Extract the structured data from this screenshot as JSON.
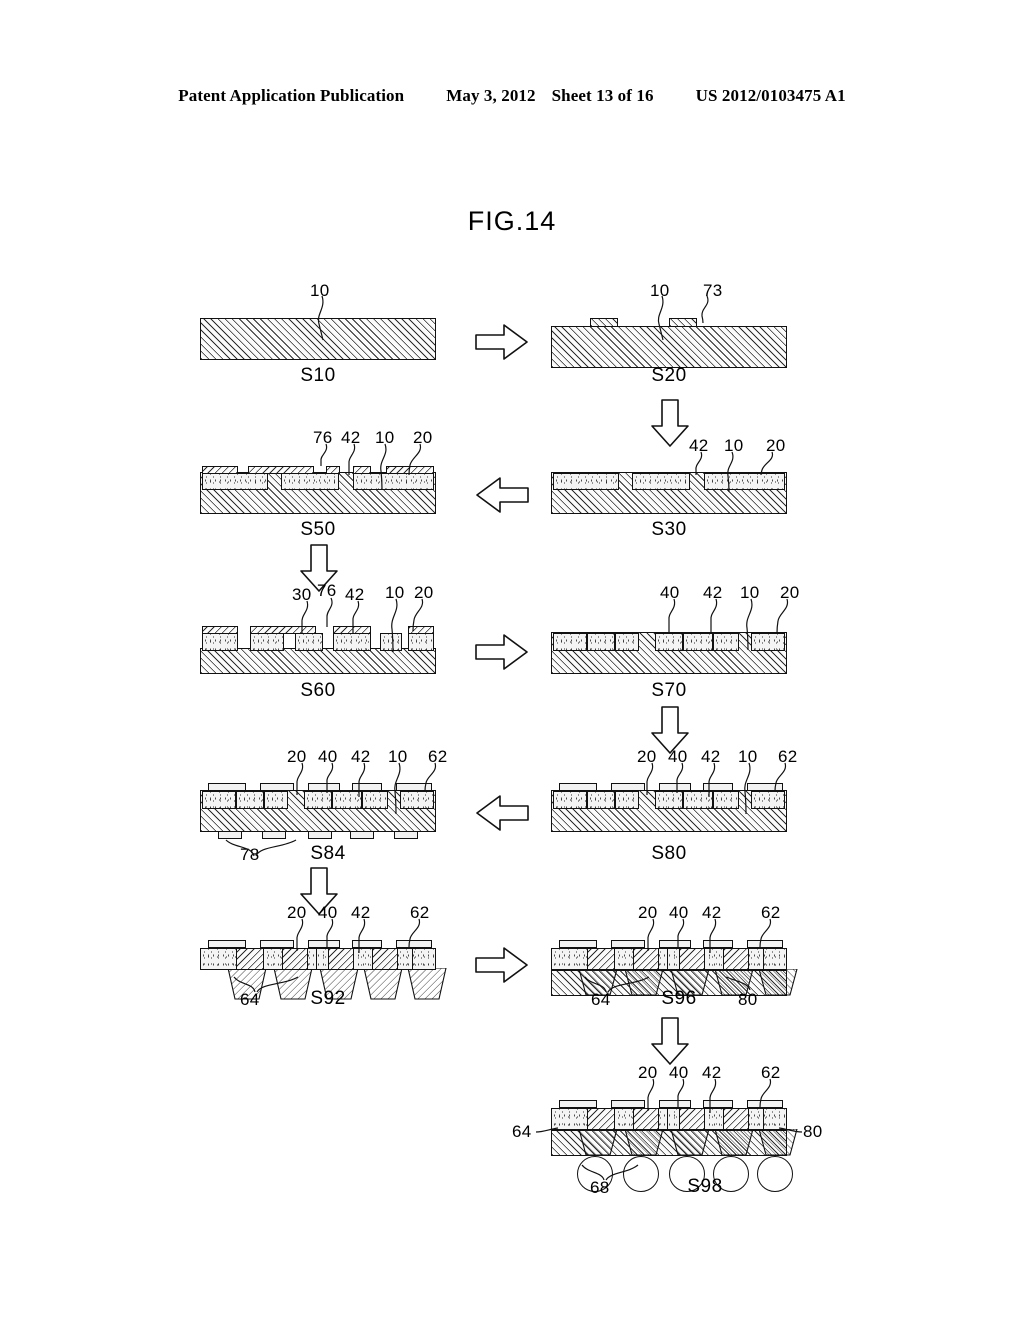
{
  "header": {
    "publication": "Patent Application Publication",
    "date": "May 3, 2012",
    "sheet": "Sheet 13 of 16",
    "docnum": "US 2012/0103475 A1"
  },
  "figure": {
    "title": "FIG.14",
    "caption_prefix": "S"
  },
  "steps": [
    {
      "id": "S10",
      "caption": "S10",
      "labels": [
        {
          "text": "10"
        }
      ]
    },
    {
      "id": "S20",
      "caption": "S20",
      "labels": [
        {
          "text": "10"
        },
        {
          "text": "73"
        }
      ]
    },
    {
      "id": "S30",
      "caption": "S30",
      "labels": [
        {
          "text": "42"
        },
        {
          "text": "10"
        },
        {
          "text": "20"
        }
      ]
    },
    {
      "id": "S50",
      "caption": "S50",
      "labels": [
        {
          "text": "76"
        },
        {
          "text": "42"
        },
        {
          "text": "10"
        },
        {
          "text": "20"
        }
      ]
    },
    {
      "id": "S60",
      "caption": "S60",
      "labels": [
        {
          "text": "30"
        },
        {
          "text": "76"
        },
        {
          "text": "42"
        },
        {
          "text": "10"
        },
        {
          "text": "20"
        }
      ]
    },
    {
      "id": "S70",
      "caption": "S70",
      "labels": [
        {
          "text": "40"
        },
        {
          "text": "42"
        },
        {
          "text": "10"
        },
        {
          "text": "20"
        }
      ]
    },
    {
      "id": "S80",
      "caption": "S80",
      "labels": [
        {
          "text": "20"
        },
        {
          "text": "40"
        },
        {
          "text": "42"
        },
        {
          "text": "10"
        },
        {
          "text": "62"
        }
      ]
    },
    {
      "id": "S84",
      "caption": "S84",
      "labels": [
        {
          "text": "20"
        },
        {
          "text": "40"
        },
        {
          "text": "42"
        },
        {
          "text": "10"
        },
        {
          "text": "62"
        },
        {
          "text": "78"
        }
      ]
    },
    {
      "id": "S92",
      "caption": "S92",
      "labels": [
        {
          "text": "20"
        },
        {
          "text": "40"
        },
        {
          "text": "42"
        },
        {
          "text": "62"
        },
        {
          "text": "64"
        }
      ]
    },
    {
      "id": "S96",
      "caption": "S96",
      "labels": [
        {
          "text": "20"
        },
        {
          "text": "40"
        },
        {
          "text": "42"
        },
        {
          "text": "62"
        },
        {
          "text": "64"
        },
        {
          "text": "80"
        }
      ]
    },
    {
      "id": "S98",
      "caption": "S98",
      "labels": [
        {
          "text": "20"
        },
        {
          "text": "40"
        },
        {
          "text": "42"
        },
        {
          "text": "62"
        },
        {
          "text": "64"
        },
        {
          "text": "80"
        },
        {
          "text": "68"
        }
      ]
    }
  ],
  "label_text": {
    "n10": "10",
    "n20": "20",
    "n30": "30",
    "n40": "40",
    "n42": "42",
    "n62": "62",
    "n64": "64",
    "n68": "68",
    "n73": "73",
    "n76": "76",
    "n78": "78",
    "n80": "80"
  },
  "captions": {
    "s10": "S10",
    "s20": "S20",
    "s30": "S30",
    "s50": "S50",
    "s60": "S60",
    "s70": "S70",
    "s80": "S80",
    "s84": "S84",
    "s92": "S92",
    "s96": "S96",
    "s98": "S98"
  },
  "flow_arrows": [
    {
      "name": "arrow-s10-to-s20",
      "direction": "right"
    },
    {
      "name": "arrow-s20-to-s30",
      "direction": "down"
    },
    {
      "name": "arrow-s30-to-s50",
      "direction": "left"
    },
    {
      "name": "arrow-s50-to-s60",
      "direction": "down"
    },
    {
      "name": "arrow-s60-to-s70",
      "direction": "right"
    },
    {
      "name": "arrow-s70-to-s80",
      "direction": "down"
    },
    {
      "name": "arrow-s80-to-s84",
      "direction": "left"
    },
    {
      "name": "arrow-s84-to-s92",
      "direction": "down"
    },
    {
      "name": "arrow-s92-to-s96",
      "direction": "right"
    },
    {
      "name": "arrow-s96-to-s98",
      "direction": "down"
    }
  ],
  "colors": {
    "ink": "#000000",
    "hatch": "#2b2b2b",
    "paper": "#ffffff"
  }
}
